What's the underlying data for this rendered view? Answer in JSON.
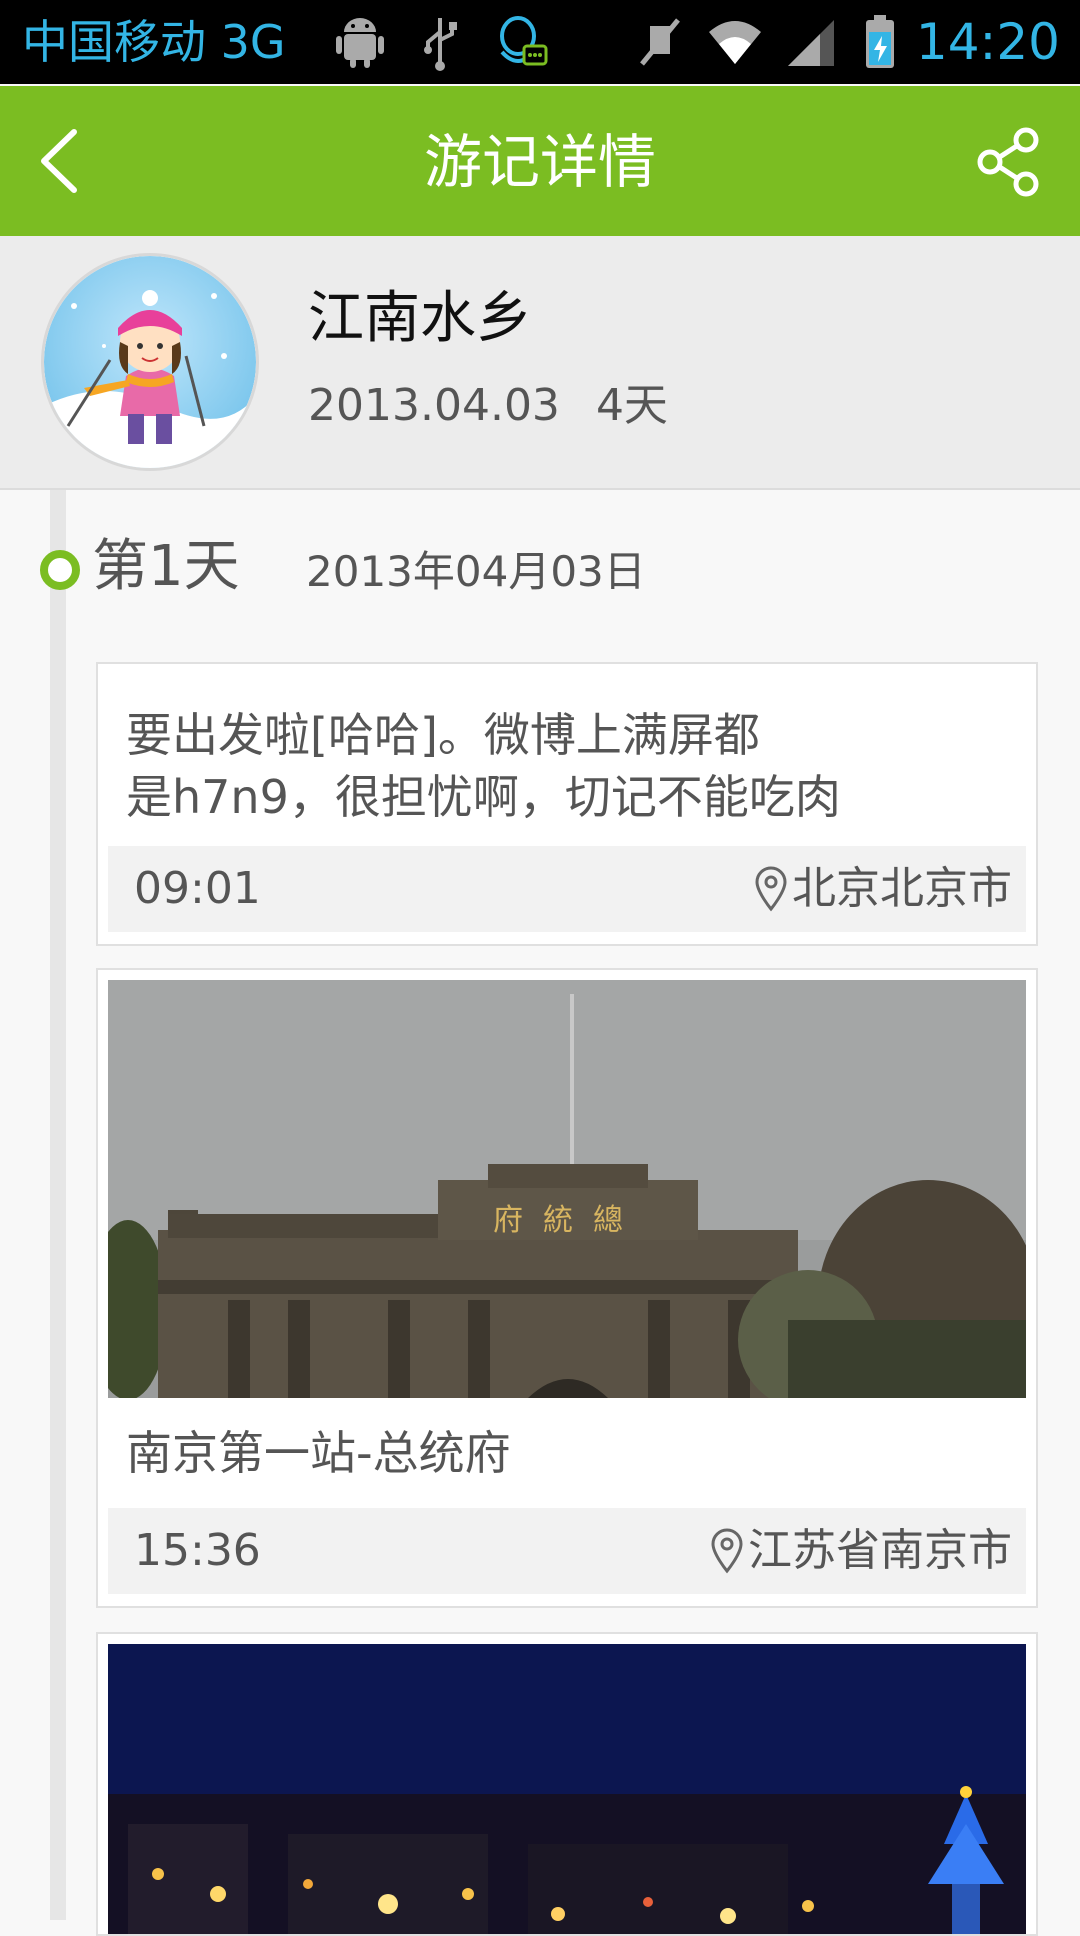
{
  "status_bar": {
    "carrier": "中国移动 3G",
    "time": "14:20",
    "icons": [
      "android-icon",
      "usb-icon",
      "qq-icon",
      "mute-icon",
      "wifi-icon",
      "signal-icon",
      "battery-icon"
    ]
  },
  "header": {
    "title": "游记详情",
    "back_icon": "chevron-left-icon",
    "share_icon": "share-icon"
  },
  "trip": {
    "title": "江南水乡",
    "start_date": "2013.04.03",
    "duration": "4天"
  },
  "day": {
    "label": "第1天",
    "date": "2013年04月03日"
  },
  "entries": [
    {
      "text_line1": "要出发啦[哈哈]。微博上满屏都",
      "text_line2": "是h7n9，很担忧啊，切记不能吃肉",
      "time": "09:01",
      "location": "北京北京市"
    },
    {
      "caption": "南京第一站-总统府",
      "time": "15:36",
      "location": "江苏省南京市",
      "sign_text": "府統總"
    },
    {}
  ],
  "colors": {
    "accent": "#7bbd22",
    "status_text": "#33b5e5"
  }
}
